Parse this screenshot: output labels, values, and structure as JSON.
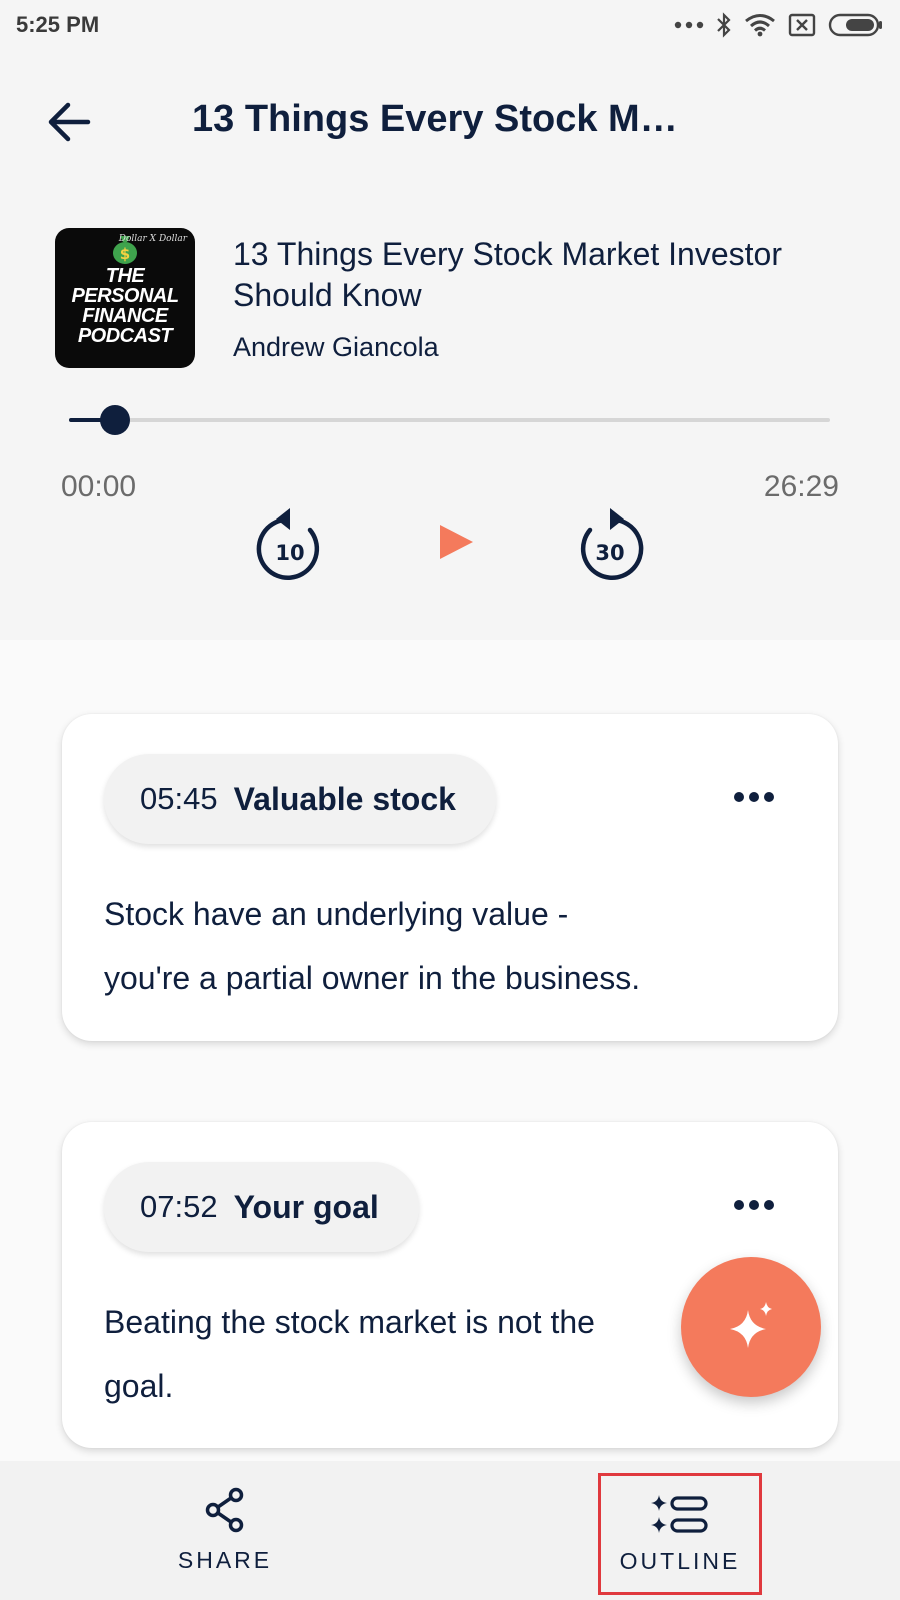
{
  "status_bar": {
    "time": "5:25 PM",
    "icons": [
      "more-dots-icon",
      "bluetooth-icon",
      "wifi-icon",
      "no-sim-icon",
      "battery-icon"
    ]
  },
  "header": {
    "title": "13 Things Every Stock M…",
    "back_icon": "arrow-left-icon"
  },
  "episode": {
    "cover_brand": "Dollar X Dollar",
    "cover_text": [
      "THE",
      "PERSONAL",
      "FINANCE",
      "PODCAST"
    ],
    "title": "13 Things Every Stock Market Investor Should Know",
    "author": "Andrew Giancola"
  },
  "player": {
    "current_time": "00:00",
    "total_time": "26:29",
    "progress": 0.06,
    "rewind_label": "10",
    "forward_label": "30",
    "accent_color": "#f47a5c",
    "primary_color": "#0f1f3d"
  },
  "highlights": [
    {
      "time": "05:45",
      "label": "Valuable stock",
      "text_lines": [
        "Stock have an underlying value -",
        "you're a partial owner in the business."
      ]
    },
    {
      "time": "07:52",
      "label": "Your goal",
      "text_lines": [
        "Beating the stock market is not the",
        "goal."
      ]
    }
  ],
  "fab": {
    "icon": "sparkle-icon"
  },
  "bottom_nav": {
    "share_label": "SHARE",
    "outline_label": "OUTLINE",
    "highlight_color": "#e0393e"
  }
}
